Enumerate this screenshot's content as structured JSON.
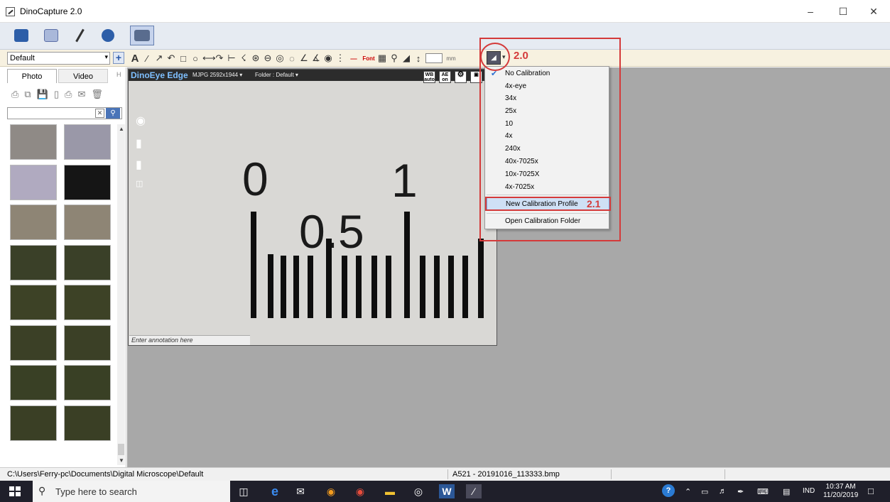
{
  "window": {
    "title": "DinoCapture 2.0",
    "minimize": "–",
    "maximize": "☐",
    "close": "✕"
  },
  "toolbar": {
    "profile": "Default",
    "add": "+",
    "text_tool": "A",
    "font_label": "Font",
    "unit_label": "mm"
  },
  "left_panel": {
    "tabs": [
      "Photo",
      "Video"
    ],
    "collapse": "H"
  },
  "viewer": {
    "brand": "DinoEye Edge",
    "resolution": "MJPG 2592x1944 ▾",
    "folder": "Folder : Default ▾",
    "wb_label": "WB auto",
    "ae_label": "AE on",
    "annotation_placeholder": "Enter annotation here",
    "scale_labels": [
      "0",
      "1",
      "0.5"
    ]
  },
  "calibration_menu": {
    "items": [
      "No Calibration",
      "4x-eye",
      "34x",
      "25x",
      "10",
      "4x",
      "240x",
      "40x-7025x",
      "10x-7025X",
      "4x-7025x"
    ],
    "checked": "No Calibration",
    "new_profile": "New Calibration Profile",
    "open_folder": "Open Calibration Folder"
  },
  "annotations": {
    "step1": "2.0",
    "step2": "2.1",
    "color": "#d43a3a"
  },
  "status": {
    "path": "C:\\Users\\Ferry-pc\\Documents\\Digital Microscope\\Default",
    "file": "A521 - 20191016_113333.bmp"
  },
  "taskbar": {
    "search_placeholder": "Type here to search",
    "language": "IND",
    "time": "10:37 AM",
    "date": "11/20/2019"
  }
}
